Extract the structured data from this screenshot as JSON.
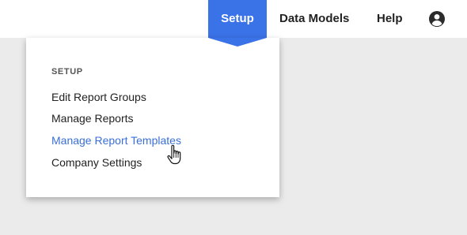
{
  "topbar": {
    "nav": [
      {
        "label": "Setup",
        "active": true
      },
      {
        "label": "Data Models",
        "active": false
      },
      {
        "label": "Help",
        "active": false
      }
    ],
    "account_icon": "account-circle-icon"
  },
  "dropdown": {
    "section_title": "SETUP",
    "items": [
      {
        "label": "Edit Report Groups"
      },
      {
        "label": "Manage Reports"
      },
      {
        "label": "Manage Report Templates",
        "hovered": true
      },
      {
        "label": "Company Settings"
      }
    ]
  },
  "cursor_icon": "hand-pointer-icon",
  "colors": {
    "accent": "#3a72e8",
    "link_hover": "#3a6fd8",
    "background": "#ebebeb"
  }
}
